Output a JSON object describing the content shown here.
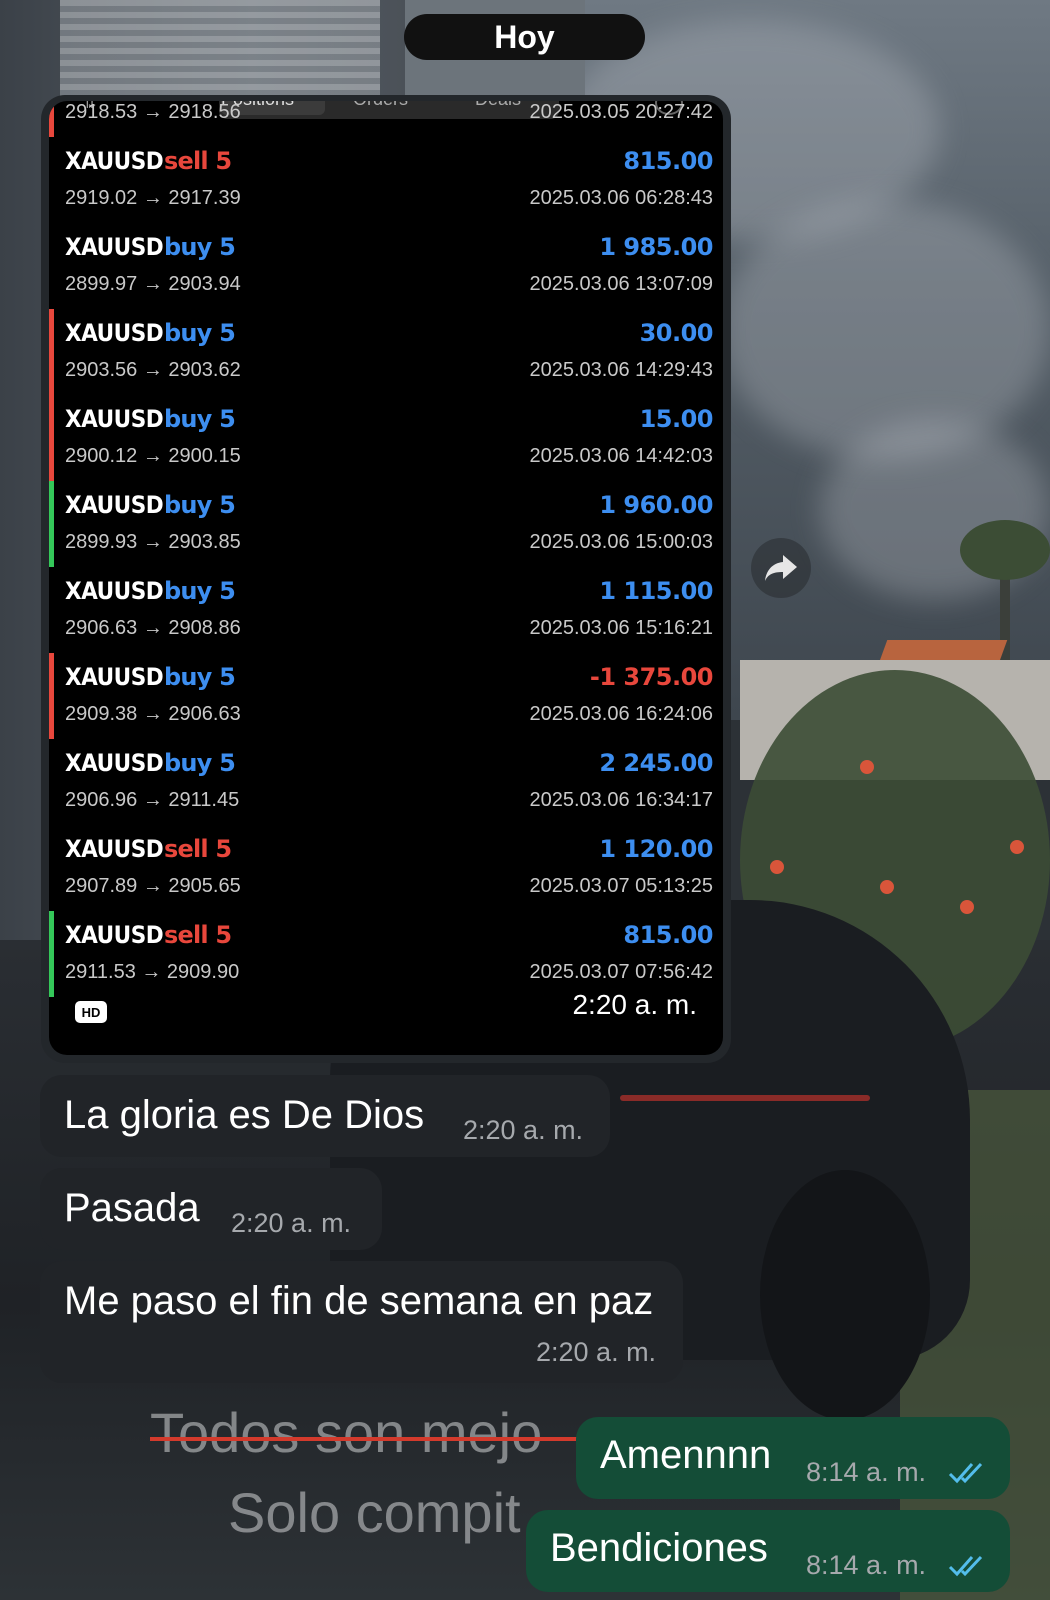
{
  "date_divider": "Hoy",
  "screenshot": {
    "tabs": [
      "Positions",
      "Orders",
      "Deals"
    ],
    "partial_top_row": {
      "prices": "2918.53 → 2918.56",
      "time": "2025.03.05 20:27:42"
    },
    "trades": [
      {
        "symbol": "XAUUSD",
        "side": "sell 5",
        "direction": "sell",
        "prices": "2919.02 → 2917.39",
        "profit": "815.00",
        "time": "2025.03.06 06:28:43",
        "bar": "none"
      },
      {
        "symbol": "XAUUSD",
        "side": "buy 5",
        "direction": "buy",
        "prices": "2899.97 → 2903.94",
        "profit": "1 985.00",
        "time": "2025.03.06 13:07:09",
        "bar": "none"
      },
      {
        "symbol": "XAUUSD",
        "side": "buy 5",
        "direction": "buy",
        "prices": "2903.56 → 2903.62",
        "profit": "30.00",
        "time": "2025.03.06 14:29:43",
        "bar": "red"
      },
      {
        "symbol": "XAUUSD",
        "side": "buy 5",
        "direction": "buy",
        "prices": "2900.12 → 2900.15",
        "profit": "15.00",
        "time": "2025.03.06 14:42:03",
        "bar": "red"
      },
      {
        "symbol": "XAUUSD",
        "side": "buy 5",
        "direction": "buy",
        "prices": "2899.93 → 2903.85",
        "profit": "1 960.00",
        "time": "2025.03.06 15:00:03",
        "bar": "green"
      },
      {
        "symbol": "XAUUSD",
        "side": "buy 5",
        "direction": "buy",
        "prices": "2906.63 → 2908.86",
        "profit": "1 115.00",
        "time": "2025.03.06 15:16:21",
        "bar": "none"
      },
      {
        "symbol": "XAUUSD",
        "side": "buy 5",
        "direction": "buy",
        "prices": "2909.38 → 2906.63",
        "profit": "-1 375.00",
        "time": "2025.03.06 16:24:06",
        "bar": "red"
      },
      {
        "symbol": "XAUUSD",
        "side": "buy 5",
        "direction": "buy",
        "prices": "2906.96 → 2911.45",
        "profit": "2 245.00",
        "time": "2025.03.06 16:34:17",
        "bar": "none"
      },
      {
        "symbol": "XAUUSD",
        "side": "sell 5",
        "direction": "sell",
        "prices": "2907.89 → 2905.65",
        "profit": "1 120.00",
        "time": "2025.03.07 05:13:25",
        "bar": "none"
      },
      {
        "symbol": "XAUUSD",
        "side": "sell 5",
        "direction": "sell",
        "prices": "2911.53 → 2909.90",
        "profit": "815.00",
        "time": "2025.03.07 07:56:42",
        "bar": "green"
      }
    ],
    "hd_badge": "HD",
    "timestamp": "2:20 a. m."
  },
  "messages": [
    {
      "text": "La gloria es De Dios",
      "time": "2:20 a. m.",
      "direction": "incoming"
    },
    {
      "text": "Pasada",
      "time": "2:20 a. m.",
      "direction": "incoming"
    },
    {
      "text": "Me paso el fin de semana en paz",
      "time": "2:20 a. m.",
      "direction": "incoming"
    },
    {
      "text": "Amennnn",
      "time": "8:14 a. m.",
      "direction": "outgoing",
      "read": true
    },
    {
      "text": "Bendiciones",
      "time": "8:14 a. m.",
      "direction": "outgoing",
      "read": true
    }
  ],
  "wallpaper_text": {
    "line1": "Todos son mejo",
    "line2": "Solo compit"
  },
  "colors": {
    "incoming_bubble": "#212428",
    "outgoing_bubble": "#144d37",
    "buy": "#3d8ef0",
    "sell": "#e8473c",
    "profit": "#3d8ef0",
    "loss": "#e8473c",
    "read_ticks": "#53bdeb"
  },
  "icons": {
    "forward": "forward-arrow-icon",
    "read_receipt": "double-check-icon"
  }
}
